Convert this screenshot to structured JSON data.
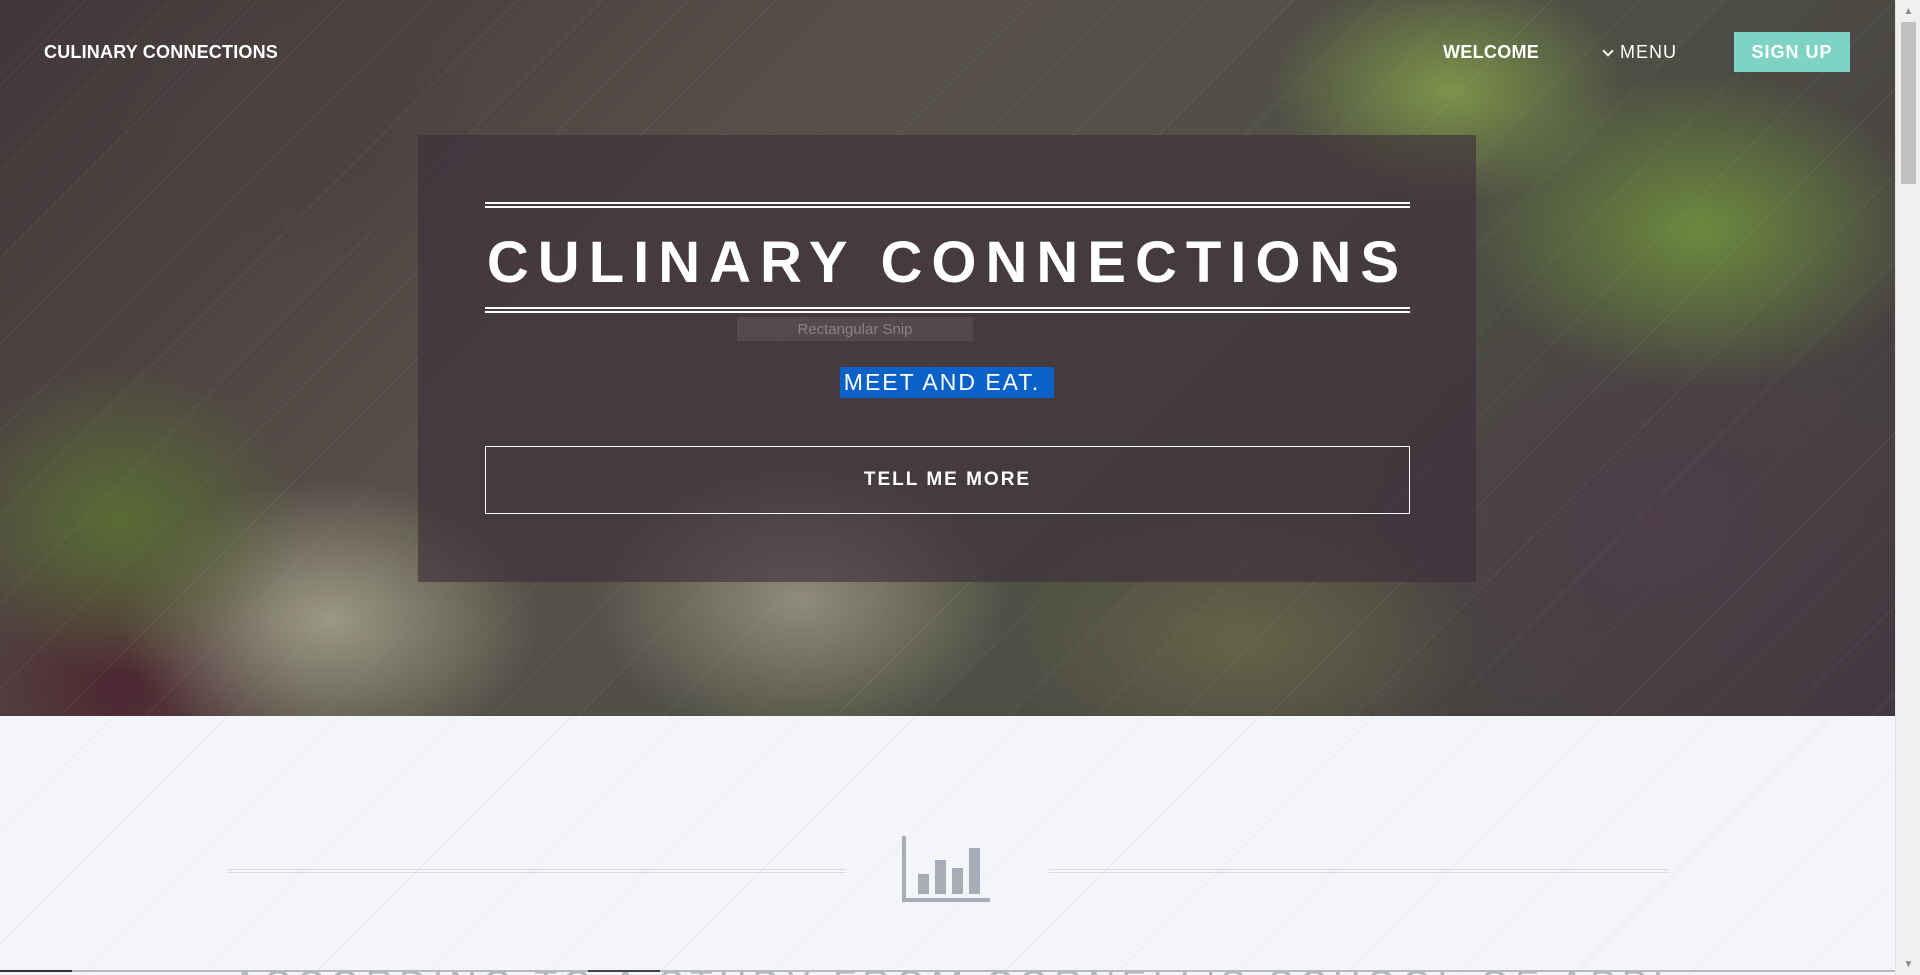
{
  "nav": {
    "brand": "CULINARY CONNECTIONS",
    "welcome": "WELCOME",
    "menu": "MENU",
    "signup": "SIGN UP"
  },
  "hero": {
    "title": "CULINARY CONNECTIONS",
    "snip_label": "Rectangular Snip",
    "tagline": "MEET AND EAT.",
    "cta": "TELL ME MORE"
  },
  "section": {
    "icon": "bar-chart-icon",
    "text": "ACCORDING TO A STUDY FROM CORNELL'S SCHOOL OF APPLIED ECONOMICS"
  },
  "colors": {
    "accent": "#7fd3c4",
    "selection": "#0a62c9",
    "section_bg": "#f3f5f9"
  }
}
